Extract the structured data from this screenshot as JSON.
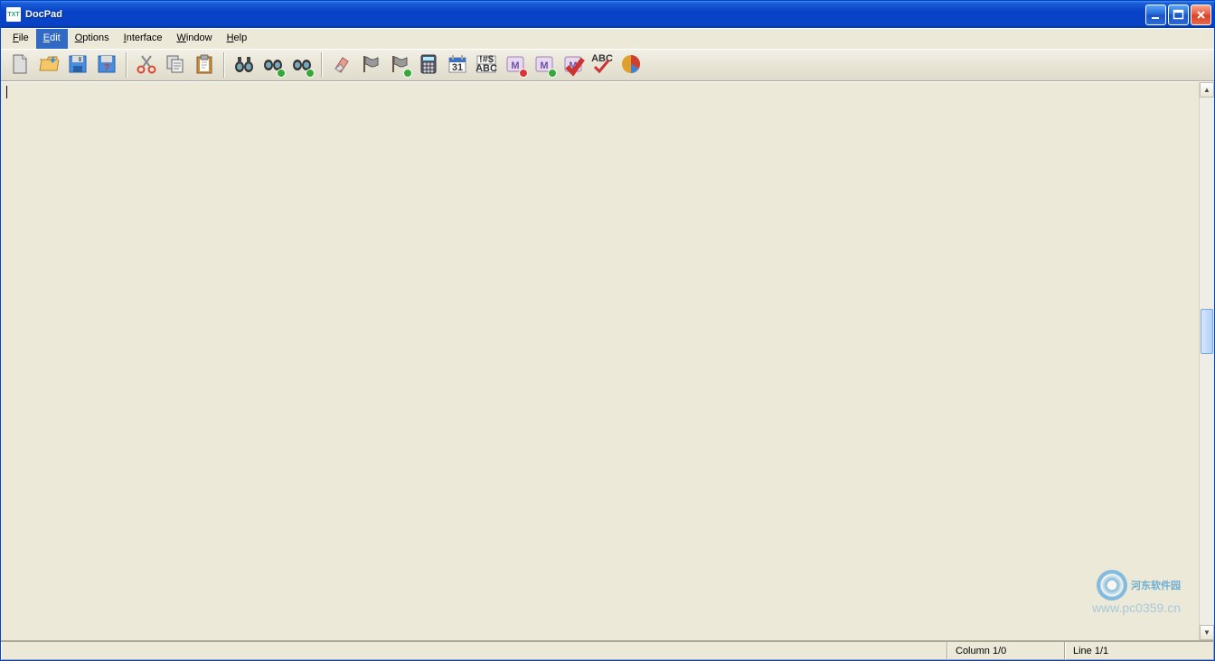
{
  "titlebar": {
    "app_name": "DocPad",
    "icon_label": "TXT"
  },
  "menus": {
    "file": "File",
    "edit": "Edit",
    "options": "Options",
    "interface": "Interface",
    "window": "Window",
    "help": "Help"
  },
  "toolbar": {
    "new": "New",
    "open": "Open",
    "save": "Save",
    "save_help": "?",
    "cut": "Cut",
    "copy": "Copy",
    "paste": "Paste",
    "find": "Find",
    "find_next": "Find Next",
    "find_prev": "Find Prev",
    "erase": "Erase",
    "flag1": "Bookmark",
    "flag2": "Bookmark Add",
    "calc": "Calculator",
    "date": "31",
    "chars": "!#$",
    "chars2": "ABC",
    "m_rec": "M",
    "m_play": "M",
    "m_check": "M",
    "spell_top": "ABC",
    "chart": "Chart"
  },
  "editor": {
    "content": ""
  },
  "status": {
    "column": "Column 1/0",
    "line": "Line 1/1"
  },
  "watermark": {
    "text": "河东软件园",
    "url": "www.pc0359.cn"
  }
}
